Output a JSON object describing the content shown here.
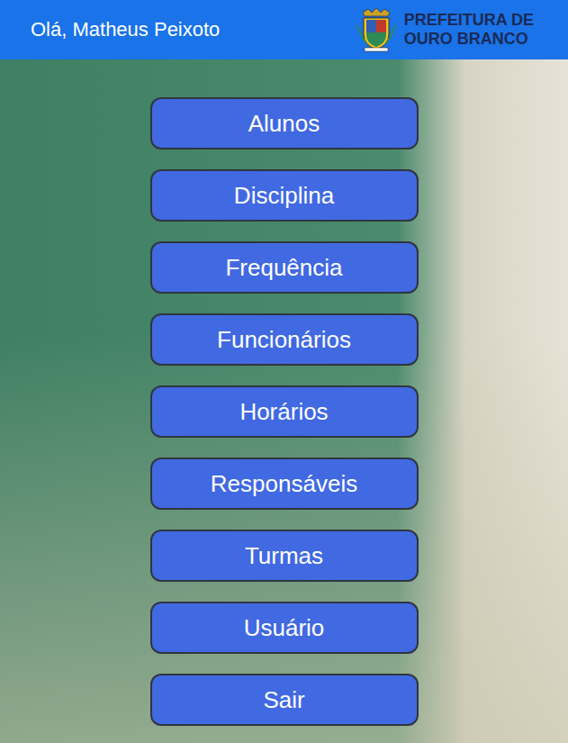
{
  "header": {
    "greeting": "Olá, Matheus Peixoto",
    "logo": {
      "lines": [
        "PREFEITURA DE",
        "OURO BRANCO"
      ]
    }
  },
  "menu": {
    "items": [
      "Alunos",
      "Disciplina",
      "Frequência",
      "Funcionários",
      "Horários",
      "Responsáveis",
      "Turmas",
      "Usuário",
      "Sair"
    ]
  }
}
